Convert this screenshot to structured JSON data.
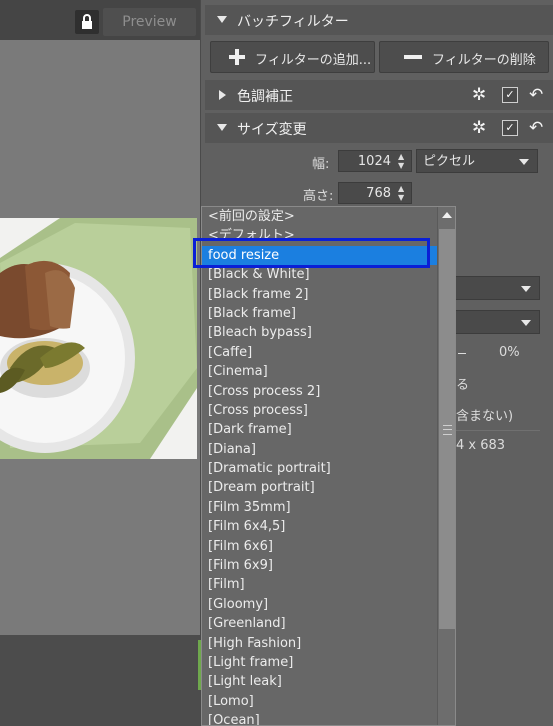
{
  "preview_panel": {
    "preview_label": "Preview"
  },
  "batch_filter": {
    "header_title": "バッチフィルター",
    "add_filter_label": "フィルターの追加...",
    "remove_filter_label": "フィルターの削除"
  },
  "sections": [
    {
      "title": "色調補正"
    },
    {
      "title": "サイズ変更"
    }
  ],
  "resize": {
    "width_label": "幅:",
    "width_value": "1024",
    "height_label": "高さ:",
    "height_value": "768",
    "unit_value": "ピクセル",
    "percent_value": "0%",
    "partial_text_1": "る",
    "partial_text_2": "含まない)",
    "partial_text_3": "4 x 683"
  },
  "preset_dropdown": {
    "items": [
      "<前回の設定>",
      "<デフォルト>",
      "food resize",
      "[Black & White]",
      "[Black frame 2]",
      "[Black frame]",
      "[Bleach bypass]",
      "[Caffe]",
      "[Cinema]",
      "[Cross process 2]",
      "[Cross process]",
      "[Dark frame]",
      "[Diana]",
      "[Dramatic portrait]",
      "[Dream portrait]",
      "[Film 35mm]",
      "[Film 6x4,5]",
      "[Film 6x6]",
      "[Film 6x9]",
      "[Film]",
      "[Gloomy]",
      "[Greenland]",
      "[High Fashion]",
      "[Light frame]",
      "[Light leak]",
      "[Lomo]",
      "[Ocean]"
    ],
    "selected": "food resize"
  },
  "colors": {
    "selection": "#1b7fe0",
    "highlight_box": "#0a1fd6"
  }
}
